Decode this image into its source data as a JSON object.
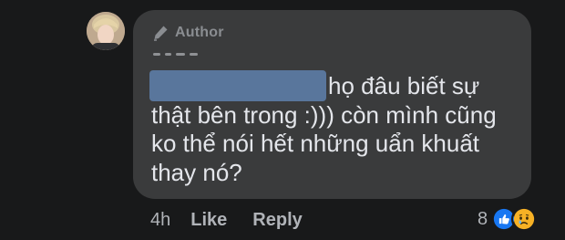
{
  "comment": {
    "author_badge": "Author",
    "text_lines": [
      "họ đâu biết sự",
      "thật bên trong :))) còn mình cũng",
      "ko thể nói hết những uẩn khuất",
      "thay nó?"
    ]
  },
  "actions": {
    "time": "4h",
    "like_label": "Like",
    "reply_label": "Reply"
  },
  "reactions": {
    "count": "8",
    "icons": [
      "like-reaction-icon",
      "sad-reaction-icon"
    ]
  },
  "icons": {
    "author": "pen-icon"
  },
  "colors": {
    "background": "#18191a",
    "bubble": "#3a3b3c",
    "text": "#e4e6eb",
    "muted": "#b0b3b8",
    "like_blue": "#1877f2",
    "sad_yellow": "#f7b125"
  }
}
